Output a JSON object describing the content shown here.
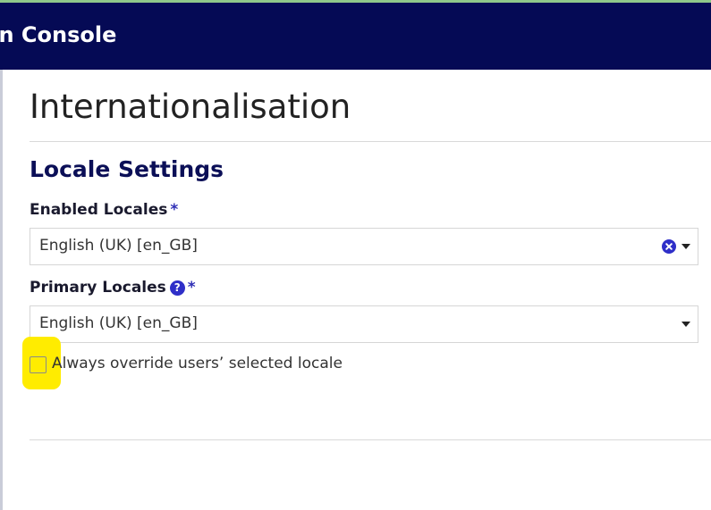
{
  "header": {
    "title": "on Console",
    "background_color": "#050a55",
    "accent_strip_color": "#8fc98a"
  },
  "page": {
    "title": "Internationalisation"
  },
  "locale_settings": {
    "section_title": "Locale Settings",
    "enabled_locales": {
      "label": "Enabled Locales",
      "required_mark": "*",
      "selected_value": "English (UK) [en_GB]",
      "clear_icon": "times-circle-icon",
      "dropdown_icon": "caret-down-icon"
    },
    "primary_locales": {
      "label": "Primary Locales",
      "help_icon_glyph": "?",
      "help_icon": "question-circle-icon",
      "required_mark": "*",
      "selected_value": "English (UK) [en_GB]",
      "dropdown_icon": "caret-down-icon"
    },
    "override_checkbox": {
      "label": "Always override users’ selected locale",
      "checked": false,
      "highlight_color": "#ffec00"
    }
  }
}
